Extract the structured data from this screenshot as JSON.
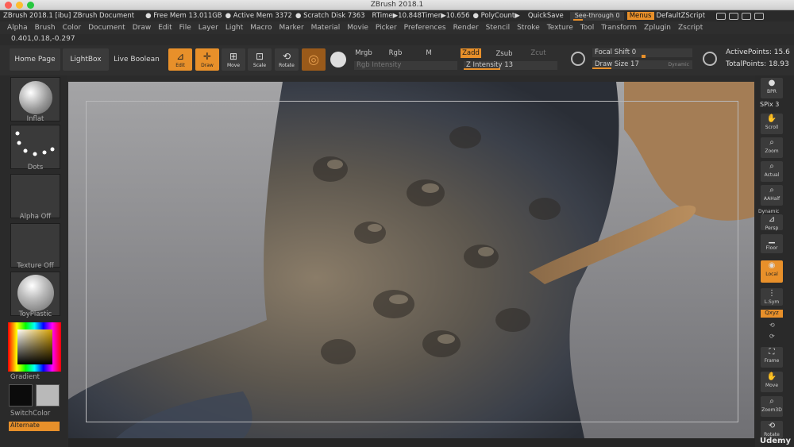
{
  "window": {
    "title": "ZBrush 2018.1"
  },
  "status": {
    "app": "ZBrush 2018.1 [ibu] ZBrush Document",
    "free_mem": "● Free Mem 13.011GB",
    "active_mem": "● Active Mem 3372",
    "scratch": "● Scratch Disk 7363",
    "rtime": "RTime▶10.848",
    "timer": "Timer▶10.656",
    "polycount": "● PolyCount▶",
    "quicksave": "QuickSave",
    "see_through": "See-through  0",
    "menus": "Menus",
    "script": "DefaultZScript"
  },
  "menubar": [
    "Alpha",
    "Brush",
    "Color",
    "Document",
    "Draw",
    "Edit",
    "File",
    "Layer",
    "Light",
    "Macro",
    "Marker",
    "Material",
    "Movie",
    "Picker",
    "Preferences",
    "Render",
    "Stencil",
    "Stroke",
    "Texture",
    "Tool",
    "Transform",
    "Zplugin",
    "Zscript"
  ],
  "coord": "0.401,0.18,-0.297",
  "toolbar": {
    "home_page": "Home Page",
    "lightbox": "LightBox",
    "live_boolean": "Live Boolean",
    "edit": "Edit",
    "draw": "Draw",
    "move": "Move",
    "scale": "Scale",
    "rotate": "Rotate",
    "mrgb": "Mrgb",
    "rgb": "Rgb",
    "m": "M",
    "rgb_intensity": "Rgb Intensity",
    "zadd": "Zadd",
    "zsub": "Zsub",
    "zcut": "Zcut",
    "z_intensity": "Z Intensity 13",
    "focal_shift": "Focal Shift 0",
    "draw_size": "Draw Size 17",
    "dynamic": "Dynamic",
    "active_points": "ActivePoints: 15.6",
    "total_points": "TotalPoints: 18.93"
  },
  "leftshelf": {
    "brush": "Inflat",
    "stroke": "Dots",
    "alpha": "Alpha Off",
    "texture": "Texture Off",
    "material": "ToyPlastic",
    "gradient": "Gradient",
    "switchcolor": "SwitchColor",
    "alternate": "Alternate"
  },
  "rightshelf": {
    "bpr": "BPR",
    "spix": "SPix 3",
    "scroll": "Scroll",
    "zoom": "Zoom",
    "actual": "Actual",
    "aahalf": "AAHalf",
    "dynamic": "Dynamic",
    "persp": "Persp",
    "floor": "Floor",
    "local": "Local",
    "lsym": "L.Sym",
    "xyz": "Qxyz",
    "frame": "Frame",
    "move": "Move",
    "zoom3d": "Zoom3D",
    "rotate": "Rotate"
  },
  "watermark": "Udemy",
  "colors": {
    "accent": "#e8902a",
    "panel": "#2f2f2f",
    "button": "#3b3b3b"
  }
}
